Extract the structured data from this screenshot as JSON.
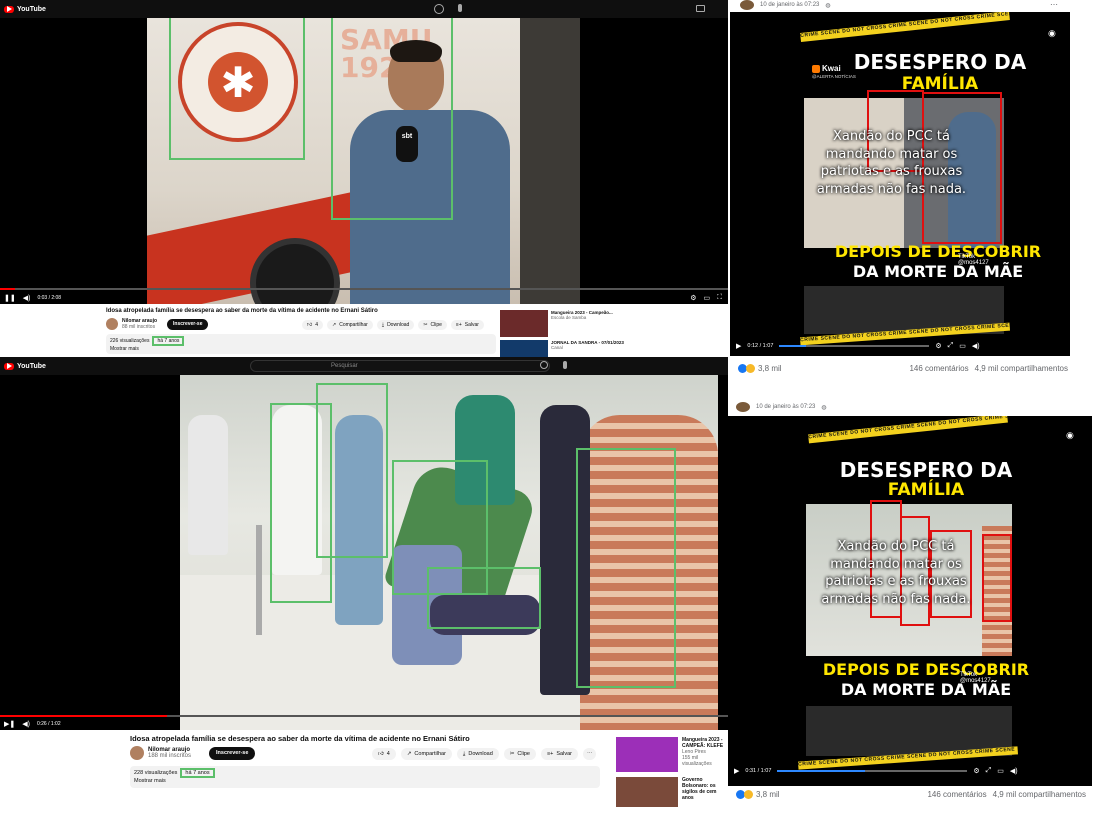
{
  "yt1": {
    "logo": "YouTube",
    "time": "0:03 / 2:08",
    "title": "Idosa atropelada família se desespera ao saber da morte da vítima de acidente no Ernani Sátiro",
    "channel": "Nilomar araujo",
    "subscribers": "88 mil inscritos",
    "subscribe": "Inscrever-se",
    "likes": "4",
    "share": "Compartilhar",
    "download": "Download",
    "clip": "Clipe",
    "save": "Salvar",
    "views": "226 visualizações",
    "age": "há 7 anos",
    "more": "Mostrar mais",
    "samu_text": "SAMU 192",
    "reporter_mic": "sbt",
    "rec": [
      {
        "title": "Mangueira 2023 - Campeão...",
        "meta": "Escola de Samba"
      },
      {
        "title": "JORNAL DA SANDRA - 07/01/2023",
        "meta": "Canal"
      }
    ]
  },
  "yt2": {
    "logo": "YouTube",
    "search_placeholder": "Pesquisar",
    "time": "0:26 / 1:02",
    "title": "Idosa atropelada família se desespera ao saber da morte da vítima de acidente no Ernani Sátiro",
    "channel": "Nilomar araujo",
    "subscribers": "188 mil inscritos",
    "subscribe": "Inscrever-se",
    "likes": "4",
    "share": "Compartilhar",
    "download": "Download",
    "clip": "Clipe",
    "save": "Salvar",
    "views": "228 visualizações",
    "age": "há 7 anos",
    "more": "Mostrar mais",
    "rec": [
      {
        "title": "Mangueira 2023 - CAMPEÃ: KLEFE",
        "meta": "Leno Pires",
        "meta2": "155 mil visualizações"
      },
      {
        "title": "Governo Bolsonaro: os sigilos de cem anos",
        "meta": "",
        "meta2": ""
      }
    ]
  },
  "fb1": {
    "date": "10 de janeiro às 07:23",
    "kwai": "Kwai",
    "kwai_handle": "@ALERTA NOTÍCIAS",
    "headline1": "DESESPERO DA",
    "headline2": "FAMÍLIA",
    "overlay": "Xandão do PCC tá mandando matar os patriotas e as frouxas armadas não fas nada.",
    "headline3": "DEPOIS DE DESCOBRIR",
    "headline4": "DA MORTE DA MÃE",
    "tiktok": "TikTok",
    "tiktok_user": "@mos4127",
    "time": "0:12 / 1:07",
    "reactions": "3,8 mil",
    "comments": "146 comentários",
    "shares": "4,9 mil compartilhamentos",
    "tape": "CRIME SCENE DO NOT CROSS CRIME SCENE DO NOT CROSS CRIME SCENE"
  },
  "fb2": {
    "date": "10 de janeiro às 07:23",
    "headline1": "DESESPERO DA",
    "headline2": "FAMÍLIA",
    "overlay": "Xandão do PCC tá mandando matar os patriotas e as frouxas armadas não fas nada.",
    "headline3": "DEPOIS DE DESCOBRIR",
    "headline4": "DA MORTE DA MÃE",
    "tiktok": "TikTok",
    "tiktok_user": "@mos4127",
    "time": "0:31 / 1:07",
    "reactions": "3,8 mil",
    "comments": "146 comentários",
    "shares": "4,9 mil compartilhamentos",
    "tape": "CRIME SCENE DO NOT CROSS CRIME SCENE DO NOT CROSS CRIME SCENE"
  },
  "colors": {
    "youtube_red": "#ff0000",
    "match_green": "#5cbf6a",
    "match_red": "#e01010",
    "tape_yellow": "#f3d11e",
    "headline_white": "#ffffff",
    "headline_yellow": "#ffe600"
  }
}
